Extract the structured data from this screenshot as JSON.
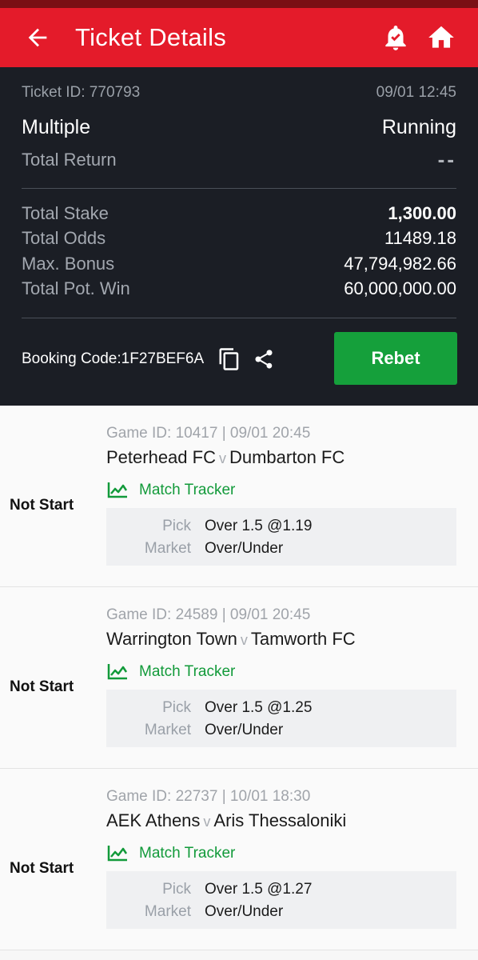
{
  "header": {
    "title": "Ticket Details"
  },
  "ticket": {
    "id_label": "Ticket ID: 770793",
    "datetime": "09/01 12:45",
    "type": "Multiple",
    "status": "Running",
    "total_return_label": "Total Return",
    "total_return_value": "--",
    "rows": [
      {
        "label": "Total Stake",
        "value": "1,300.00"
      },
      {
        "label": "Total Odds",
        "value": "11489.18"
      },
      {
        "label": "Max. Bonus",
        "value": "47,794,982.66"
      },
      {
        "label": "Total Pot. Win",
        "value": "60,000,000.00"
      }
    ],
    "booking_code_label": "Booking Code:1F27BEF6A",
    "rebet_label": "Rebet"
  },
  "selections": [
    {
      "status": "Not Start",
      "game": "Game ID: 10417 | 09/01 20:45",
      "home": "Peterhead FC",
      "vs": "v",
      "away": "Dumbarton FC",
      "tracker": "Match Tracker",
      "pick_label": "Pick",
      "pick": "Over 1.5 @1.19",
      "market_label": "Market",
      "market": "Over/Under"
    },
    {
      "status": "Not Start",
      "game": "Game ID: 24589 | 09/01 20:45",
      "home": "Warrington Town",
      "vs": "v",
      "away": "Tamworth FC",
      "tracker": "Match Tracker",
      "pick_label": "Pick",
      "pick": "Over 1.5 @1.25",
      "market_label": "Market",
      "market": "Over/Under"
    },
    {
      "status": "Not Start",
      "game": "Game ID: 22737 | 10/01 18:30",
      "home": "AEK Athens",
      "vs": "v",
      "away": "Aris Thessaloniki",
      "tracker": "Match Tracker",
      "pick_label": "Pick",
      "pick": "Over 1.5 @1.27",
      "market_label": "Market",
      "market": "Over/Under"
    }
  ],
  "colors": {
    "brand_red": "#e41b2a",
    "summary_bg": "#1b1e25",
    "rebet_green": "#15a03b",
    "tracker_green": "#129a3a"
  }
}
